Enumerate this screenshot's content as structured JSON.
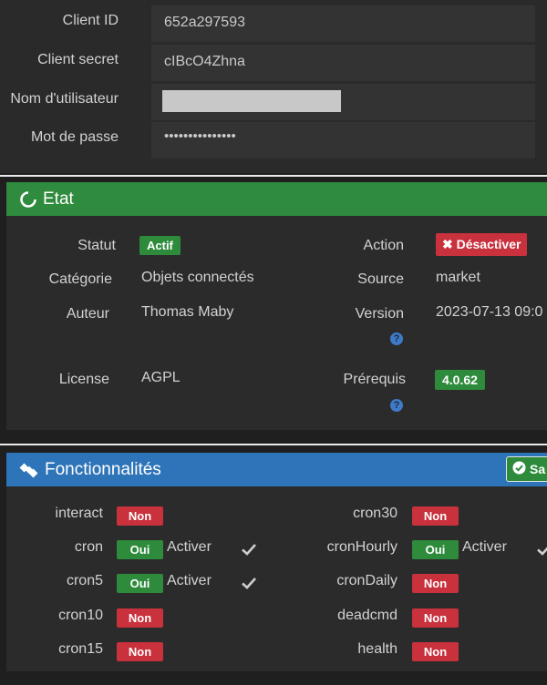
{
  "credentials": {
    "client_id_label": "Client ID",
    "client_id_value": "652a297593",
    "client_secret_label": "Client secret",
    "client_secret_value": "cIBcO4Zhna",
    "username_label": "Nom d'utilisateur",
    "password_label": "Mot de passe",
    "password_value": "•••••••••••••••"
  },
  "etat": {
    "title": "Etat",
    "statut_label": "Statut",
    "statut_value": "Actif",
    "action_label": "Action",
    "action_button": "Désactiver",
    "categorie_label": "Catégorie",
    "categorie_value": "Objets connectés",
    "source_label": "Source",
    "source_value": "market",
    "auteur_label": "Auteur",
    "auteur_value": "Thomas Maby",
    "version_label": "Version",
    "version_value": "2023-07-13 09:0",
    "license_label": "License",
    "license_value": "AGPL",
    "prerequis_label": "Prérequis",
    "prerequis_value": "4.0.62",
    "help_glyph": "?"
  },
  "fonctionnalites": {
    "title": "Fonctionnalités",
    "save_button": "Sa",
    "activer_label": "Activer",
    "left": [
      {
        "name": "interact",
        "status": "Non",
        "activer": false
      },
      {
        "name": "cron",
        "status": "Oui",
        "activer": true
      },
      {
        "name": "cron5",
        "status": "Oui",
        "activer": true
      },
      {
        "name": "cron10",
        "status": "Non",
        "activer": false
      },
      {
        "name": "cron15",
        "status": "Non",
        "activer": false
      }
    ],
    "right": [
      {
        "name": "cron30",
        "status": "Non",
        "activer": false
      },
      {
        "name": "cronHourly",
        "status": "Oui",
        "activer": true
      },
      {
        "name": "cronDaily",
        "status": "Non",
        "activer": false
      },
      {
        "name": "deadcmd",
        "status": "Non",
        "activer": false
      },
      {
        "name": "health",
        "status": "Non",
        "activer": false
      }
    ]
  },
  "colors": {
    "success": "#2e8b3c",
    "danger": "#c9313d",
    "primary": "#2e74b8"
  }
}
